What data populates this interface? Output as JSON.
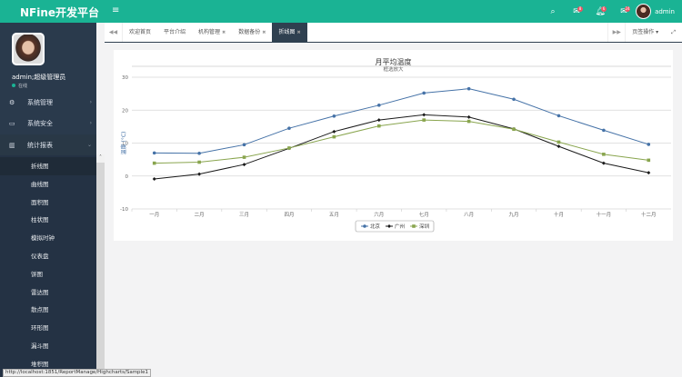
{
  "header": {
    "logo": "NFine开发平台",
    "menu_icon": "hamburger-icon",
    "user": "admin",
    "icons": [
      {
        "name": "search-icon",
        "badge": ""
      },
      {
        "name": "envelope-icon",
        "badge": "8"
      },
      {
        "name": "bell-icon",
        "badge": "6"
      },
      {
        "name": "inbox-icon",
        "badge": "24"
      }
    ]
  },
  "sidebar": {
    "user": "admin;超级管理员",
    "status": "在线",
    "menus": [
      {
        "label": "系统管理",
        "icon": "cogs-icon"
      },
      {
        "label": "系统安全",
        "icon": "desktop-icon"
      },
      {
        "label": "统计报表",
        "icon": "bar-chart-icon"
      }
    ],
    "submenu": [
      "折线图",
      "曲线图",
      "面积图",
      "柱状图",
      "模拟时钟",
      "仪表盘",
      "饼图",
      "雷达图",
      "散点图",
      "环形图",
      "漏斗图",
      "堆积图"
    ],
    "active": "折线图"
  },
  "tabs": {
    "items": [
      {
        "label": "欢迎首页",
        "closable": false
      },
      {
        "label": "平台介绍",
        "closable": false
      },
      {
        "label": "机构管理",
        "closable": true
      },
      {
        "label": "数据备份",
        "closable": true
      },
      {
        "label": "折线图",
        "closable": true,
        "active": true
      }
    ],
    "page_ops": "页签操作"
  },
  "status_url": "http://localhost:1851/ReportManage/Highcharts/Sample1",
  "chart_data": {
    "type": "line",
    "title": "月平均温度",
    "subtitle": "框选放大",
    "ylabel": "温度 (°C)",
    "categories": [
      "一月",
      "二月",
      "三月",
      "四月",
      "五月",
      "六月",
      "七月",
      "八月",
      "九月",
      "十月",
      "十一月",
      "十二月"
    ],
    "ylim": [
      -10,
      30
    ],
    "yticks": [
      -10,
      0,
      10,
      20,
      30
    ],
    "grid": true,
    "legend": "bottom-center",
    "series": [
      {
        "name": "北京",
        "color": "#4572a7",
        "marker": "circle",
        "values": [
          7.0,
          6.9,
          9.5,
          14.5,
          18.2,
          21.5,
          25.2,
          26.5,
          23.3,
          18.3,
          13.9,
          9.6
        ]
      },
      {
        "name": "广州",
        "color": "#1a1a1a",
        "marker": "diamond",
        "values": [
          -0.9,
          0.6,
          3.5,
          8.4,
          13.5,
          17.0,
          18.6,
          17.9,
          14.3,
          9.0,
          3.9,
          1.0
        ]
      },
      {
        "name": "深圳",
        "color": "#89a54e",
        "marker": "square",
        "values": [
          3.9,
          4.2,
          5.7,
          8.5,
          11.9,
          15.2,
          17.0,
          16.6,
          14.2,
          10.3,
          6.6,
          4.8
        ]
      }
    ]
  }
}
